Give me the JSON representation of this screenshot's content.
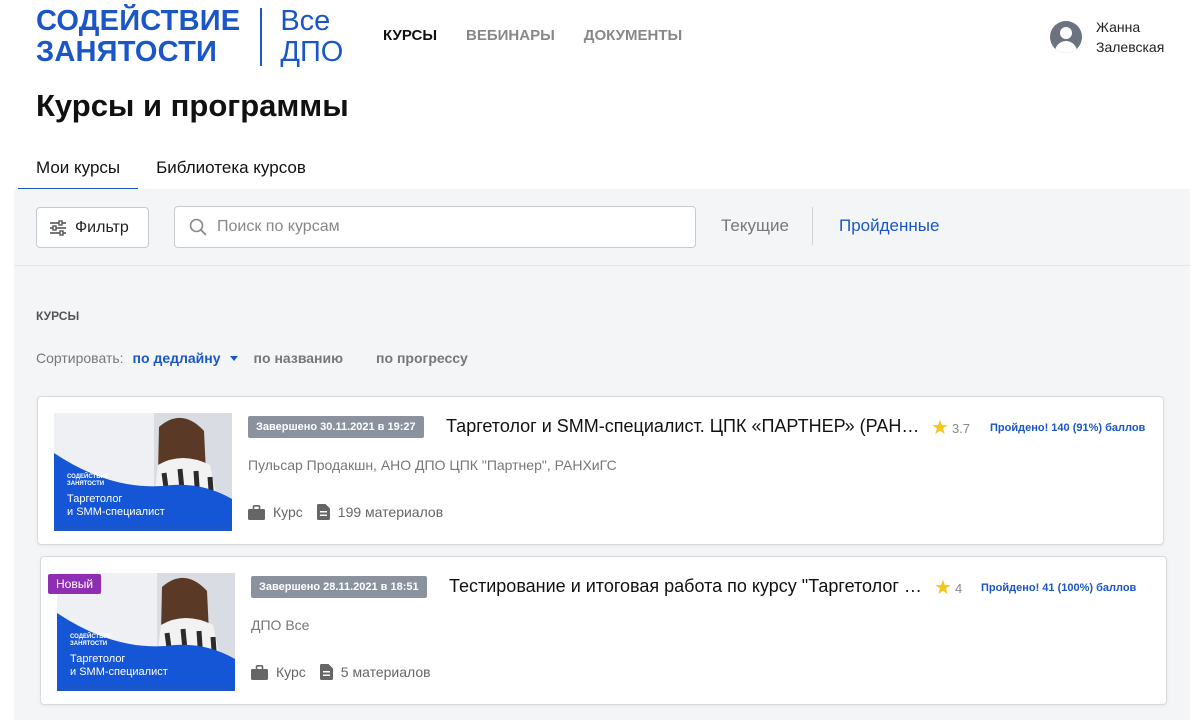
{
  "header": {
    "logo_line1": "СОДЕЙСТВИЕ",
    "logo_line2": "ЗАНЯТОСТИ",
    "logo_sub1": "Все",
    "logo_sub2": "ДПО",
    "nav": [
      {
        "label": "Курсы",
        "active": true
      },
      {
        "label": "Вебинары",
        "active": false
      },
      {
        "label": "Документы",
        "active": false
      }
    ],
    "user_first": "Жанна",
    "user_last": "Залевская"
  },
  "page_title": "Курсы и программы",
  "tabs": [
    {
      "label": "Мои курсы",
      "active": true
    },
    {
      "label": "Библиотека курсов",
      "active": false
    }
  ],
  "toolbar": {
    "filter_label": "Фильтр",
    "search_placeholder": "Поиск по курсам",
    "search_value": "",
    "status_current": "Текущие",
    "status_done": "Пройденные"
  },
  "section_label": "КУРСЫ",
  "sort": {
    "label": "Сортировать:",
    "options": [
      "по дедлайну",
      "по названию",
      "по прогрессу"
    ],
    "active": "по дедлайну"
  },
  "courses": [
    {
      "badge": "",
      "deadline": "Завершено 30.11.2021 в 19:27",
      "title": "Таргетолог и SMM-специалист. ЦПК «ПАРТНЕР» (РАНХиГС)",
      "rating": "3.7",
      "result": "Пройдено! 140 (91%) баллов",
      "provider": "Пульсар Продакшн, АНО ДПО ЦПК \"Партнер\", РАНХиГС",
      "type": "Курс",
      "materials": "199 материалов",
      "thumb_logo1": "СОДЕЙСТВИЕ",
      "thumb_logo2": "ЗАНЯТОСТИ",
      "thumb_title1": "Таргетолог",
      "thumb_title2": "и SMM-специалист"
    },
    {
      "badge": "Новый",
      "deadline": "Завершено 28.11.2021 в 18:51",
      "title": "Тестирование и итоговая работа по курсу \"Таргетолог и SMM-специалист\"",
      "rating": "4",
      "result": "Пройдено! 41 (100%) баллов",
      "provider": "ДПО Все",
      "type": "Курс",
      "materials": "5 материалов",
      "thumb_logo1": "СОДЕЙСТВИЕ",
      "thumb_logo2": "ЗАНЯТОСТИ",
      "thumb_title1": "Таргетолог",
      "thumb_title2": "и SMM-специалист"
    }
  ],
  "colors": {
    "brand": "#1a56c8",
    "new_badge": "#8e2fb3",
    "deadline_badge": "#8a929e",
    "star": "#f5c518"
  },
  "icons": {
    "filter": "sliders-icon",
    "search": "search-icon",
    "avatar": "user-avatar-icon",
    "type": "briefcase-icon",
    "materials": "document-icon",
    "rating": "star-icon"
  }
}
